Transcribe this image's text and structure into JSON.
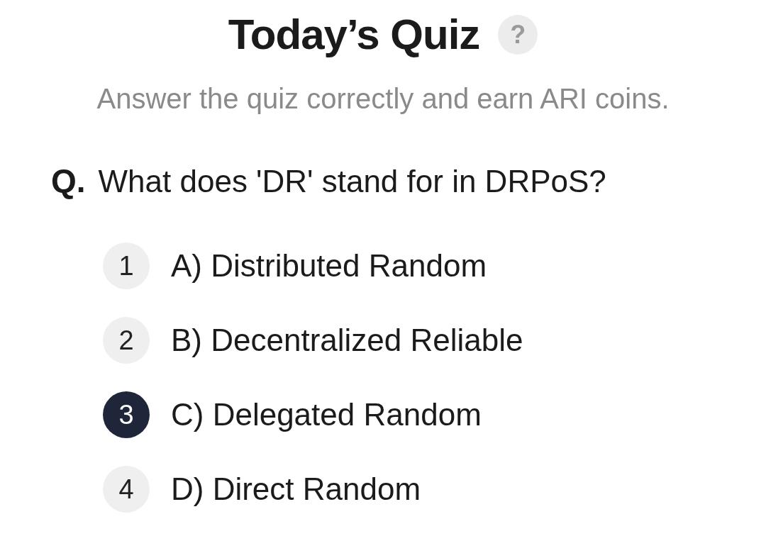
{
  "title": "Today’s Quiz",
  "help_icon": "?",
  "subtitle": "Answer the quiz correctly and earn ARI coins.",
  "question": {
    "prefix": "Q.",
    "text": "What does 'DR' stand for in DRPoS?"
  },
  "options": [
    {
      "number": "1",
      "label": "A) Distributed Random",
      "selected": false
    },
    {
      "number": "2",
      "label": "B) Decentralized Reliable",
      "selected": false
    },
    {
      "number": "3",
      "label": "C) Delegated Random",
      "selected": true
    },
    {
      "number": "4",
      "label": "D) Direct Random",
      "selected": false
    }
  ]
}
